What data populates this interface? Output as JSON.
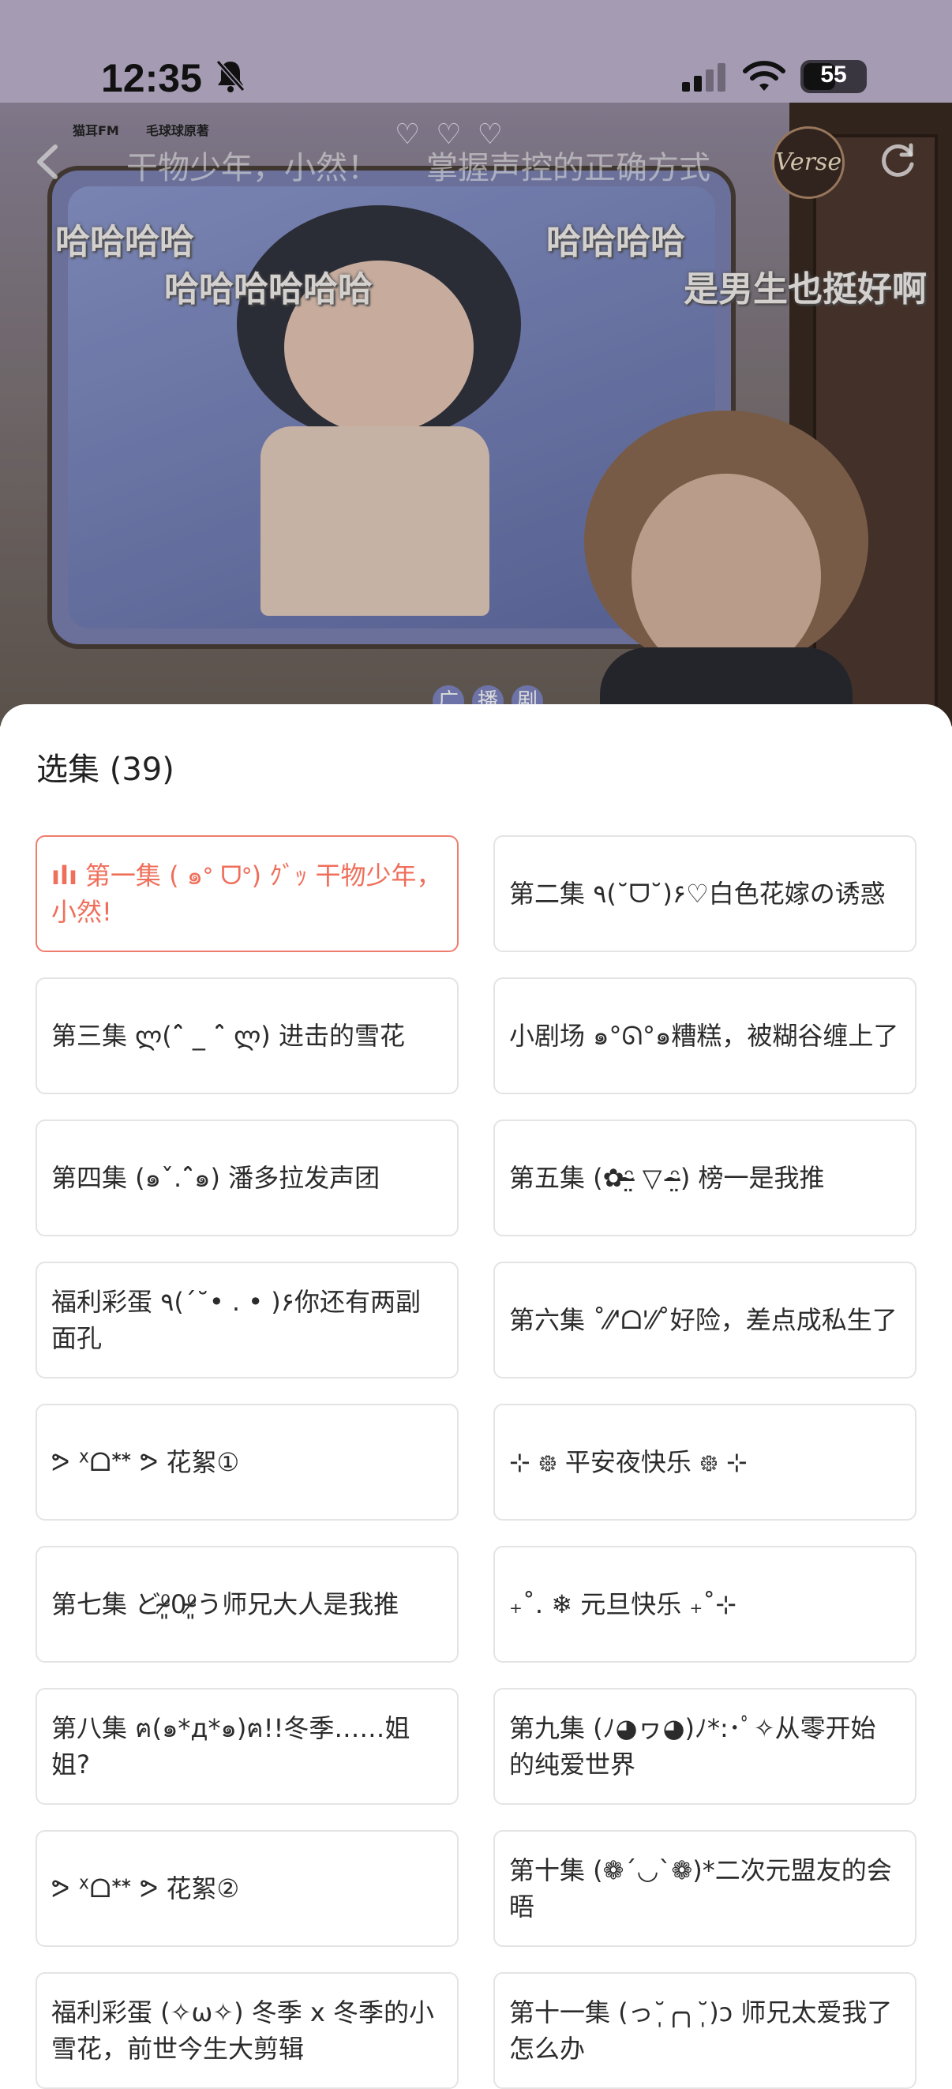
{
  "status_bar": {
    "time": "12:35",
    "battery": "55"
  },
  "cover": {
    "logos": [
      "猫耳FM",
      "毛球球原著"
    ],
    "overlay_titles": [
      "干物少年，小然！",
      "掌握声控的正确方式"
    ],
    "danmaku": [
      "哈哈哈哈",
      "哈哈哈哈哈哈",
      "哈哈哈哈",
      "是男生也挺好啊"
    ],
    "badge": "Verse",
    "tag_chars": [
      "广",
      "播",
      "剧"
    ]
  },
  "sheet": {
    "title": "选集 (39)",
    "episodes": [
      {
        "label": "第一集 ( ๑ᐤ ᗜᐤ) ｸﾞｯ 干物少年，小然!",
        "active": true
      },
      {
        "label": "第二集 ٩(˘ᗜ˘)۶♡白色花嫁の诱惑",
        "active": false
      },
      {
        "label": "第三集 ლ(ˆ̑ _ ˆ̑ ლ) 进击的雪花",
        "active": false
      },
      {
        "label": "小剧场 ๑°ᘏ°๑糟糕，被糊谷缠上了",
        "active": false
      },
      {
        "label": "第四集 (๑ˇ.ˆ̑๑) 潘多拉发声团",
        "active": false
      },
      {
        "label": "第五集 (✿ᵔ̴̶̤ ▽ ᵔ̴̶̤) 榜一是我推",
        "active": false
      },
      {
        "label": "福利彩蛋 ٩(ˊ˘• . • )۶你还有两副面孔",
        "active": false
      },
      {
        "label": "第六集 ˚⁄⁄'ᗝ'⁄⁄˚好险，差点成私生了",
        "active": false
      },
      {
        "label": "ᕗ ᕽᗝᕯ ᕗ 花絮①",
        "active": false
      },
      {
        "label": "⊹ ᪥ 平安夜快乐 ᪥ ⊹",
        "active": false
      },
      {
        "label": "第七集 ど⁰̷̴͈0⁰̷̴͈う师兄大人是我推",
        "active": false
      },
      {
        "label": "₊˚. ❄ 元旦快乐 ₊˚⊹",
        "active": false
      },
      {
        "label": "第八集 ฅ(๑*д*๑)ฅ!!冬季……姐姐?",
        "active": false
      },
      {
        "label": "第九集 (ﾉ◕ヮ◕)ﾉ*:･ﾟ✧从零开始的纯爱世界",
        "active": false
      },
      {
        "label": "ᕗ ᕽᗝᕯ ᕗ 花絮②",
        "active": false
      },
      {
        "label": "第十集 (❁´◡`❁)*二次元盟友的会晤",
        "active": false
      },
      {
        "label": "福利彩蛋 (✧ω✧) 冬季 x 冬季的小雪花，前世今生大剪辑",
        "active": false
      },
      {
        "label": "第十一集 (っ˘̩╭╮˘̩)ɔ 师兄太爱我了怎么办",
        "active": false
      }
    ]
  },
  "colors": {
    "accent": "#ef6f5b",
    "border": "#e4e4e4"
  }
}
